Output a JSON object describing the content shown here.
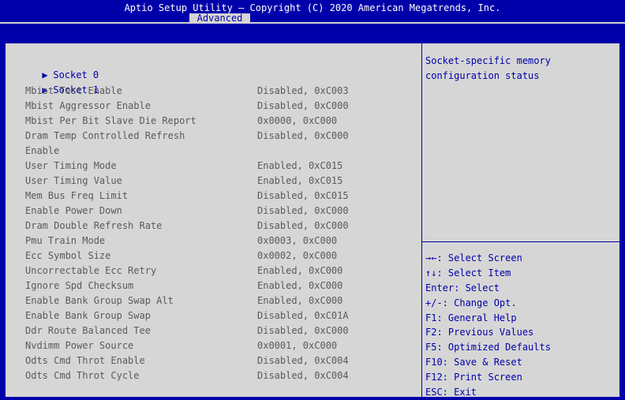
{
  "header": {
    "title": "Aptio Setup Utility – Copyright (C) 2020 American Megatrends, Inc.",
    "active_tab": "Advanced"
  },
  "submenus": [
    {
      "arrow": "▶",
      "label": "Socket 0"
    },
    {
      "arrow": "▶",
      "label": "Socket 1"
    }
  ],
  "items": [
    {
      "label": "Mbist Test Enable",
      "value": "Disabled, 0xC003"
    },
    {
      "label": "Mbist Aggressor Enable",
      "value": "Disabled, 0xC000"
    },
    {
      "label": "Mbist Per Bit Slave Die Report",
      "value": "0x0000, 0xC000"
    },
    {
      "label": "Dram Temp Controlled Refresh",
      "value": "Disabled, 0xC000"
    },
    {
      "label": "Enable",
      "value": ""
    },
    {
      "label": "User Timing Mode",
      "value": "Enabled, 0xC015"
    },
    {
      "label": "User Timing Value",
      "value": "Enabled, 0xC015"
    },
    {
      "label": "Mem Bus Freq Limit",
      "value": "Disabled, 0xC015"
    },
    {
      "label": "Enable Power Down",
      "value": "Disabled, 0xC000"
    },
    {
      "label": "Dram Double Refresh Rate",
      "value": "Disabled, 0xC000"
    },
    {
      "label": "Pmu Train Mode",
      "value": "0x0003, 0xC000"
    },
    {
      "label": "Ecc Symbol Size",
      "value": "0x0002, 0xC000"
    },
    {
      "label": "Uncorrectable Ecc Retry",
      "value": "Enabled, 0xC000"
    },
    {
      "label": "Ignore Spd Checksum",
      "value": "Enabled, 0xC000"
    },
    {
      "label": "Enable Bank Group Swap Alt",
      "value": "Enabled, 0xC000"
    },
    {
      "label": "Enable Bank Group Swap",
      "value": "Disabled, 0xC01A"
    },
    {
      "label": "Ddr Route Balanced Tee",
      "value": "Disabled, 0xC000"
    },
    {
      "label": "Nvdimm Power Source",
      "value": "0x0001, 0xC000"
    },
    {
      "label": "Odts Cmd Throt Enable",
      "value": "Disabled, 0xC004"
    },
    {
      "label": "Odts Cmd Throt Cycle",
      "value": "Disabled, 0xC004"
    }
  ],
  "help": {
    "line1": "Socket-specific memory",
    "line2": "configuration status"
  },
  "keys": [
    "→←: Select Screen",
    "↑↓: Select Item",
    "Enter: Select",
    "+/-: Change Opt.",
    "F1: General Help",
    "F2: Previous Values",
    "F5: Optimized Defaults",
    "F10: Save & Reset",
    "F12: Print Screen",
    "ESC: Exit"
  ],
  "colors": {
    "background": "#0000aa",
    "panel": "#d6d6d6",
    "accent_text": "#0000aa",
    "dim_text": "#5a5a5a",
    "title_text": "#ffffff"
  }
}
